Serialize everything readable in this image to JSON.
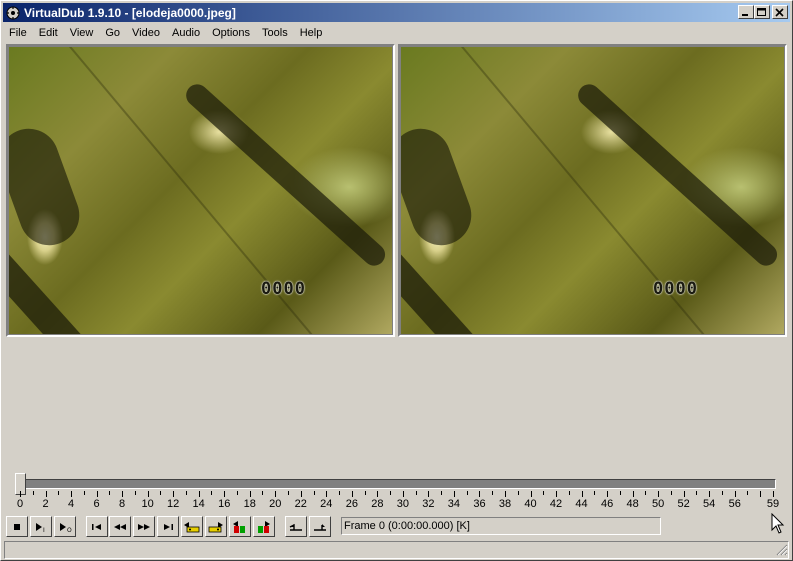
{
  "window": {
    "title": "VirtualDub 1.9.10 - [elodeja0000.jpeg]",
    "icon": "virtualdub-app-icon",
    "controls": [
      "minimize-icon",
      "maximize-icon",
      "close-icon"
    ]
  },
  "menu": {
    "items": [
      {
        "label": "File"
      },
      {
        "label": "Edit"
      },
      {
        "label": "View"
      },
      {
        "label": "Go"
      },
      {
        "label": "Video"
      },
      {
        "label": "Audio"
      },
      {
        "label": "Options"
      },
      {
        "label": "Tools"
      },
      {
        "label": "Help"
      }
    ]
  },
  "panes": {
    "input_counter": "0000",
    "output_counter": "0000"
  },
  "timeline": {
    "labels": [
      "0",
      "2",
      "4",
      "6",
      "8",
      "10",
      "12",
      "14",
      "16",
      "18",
      "20",
      "22",
      "24",
      "26",
      "28",
      "30",
      "32",
      "34",
      "36",
      "38",
      "40",
      "42",
      "44",
      "46",
      "48",
      "50",
      "52",
      "54",
      "56",
      "59"
    ],
    "max_frame": 59,
    "current_frame": 0
  },
  "toolbar": {
    "buttons": [
      {
        "icon": "stop-icon"
      },
      {
        "icon": "play-input-icon"
      },
      {
        "icon": "play-output-icon"
      },
      {
        "icon": "go-to-start-icon"
      },
      {
        "icon": "step-back-icon"
      },
      {
        "icon": "step-forward-icon"
      },
      {
        "icon": "go-to-end-icon"
      },
      {
        "icon": "prev-keyframe-icon"
      },
      {
        "icon": "next-keyframe-icon"
      },
      {
        "icon": "prev-scene-icon"
      },
      {
        "icon": "next-scene-icon"
      },
      {
        "icon": "mark-in-icon"
      },
      {
        "icon": "mark-out-icon"
      }
    ],
    "frame_status": "Frame 0 (0:00:00.000) [K]"
  },
  "colors": {
    "titlebar_start": "#0a246a",
    "titlebar_end": "#a6caf0",
    "face": "#d4d0c8",
    "keyframe_yellow": "#e8d000",
    "scene_red": "#d00000",
    "scene_green": "#00a000"
  }
}
